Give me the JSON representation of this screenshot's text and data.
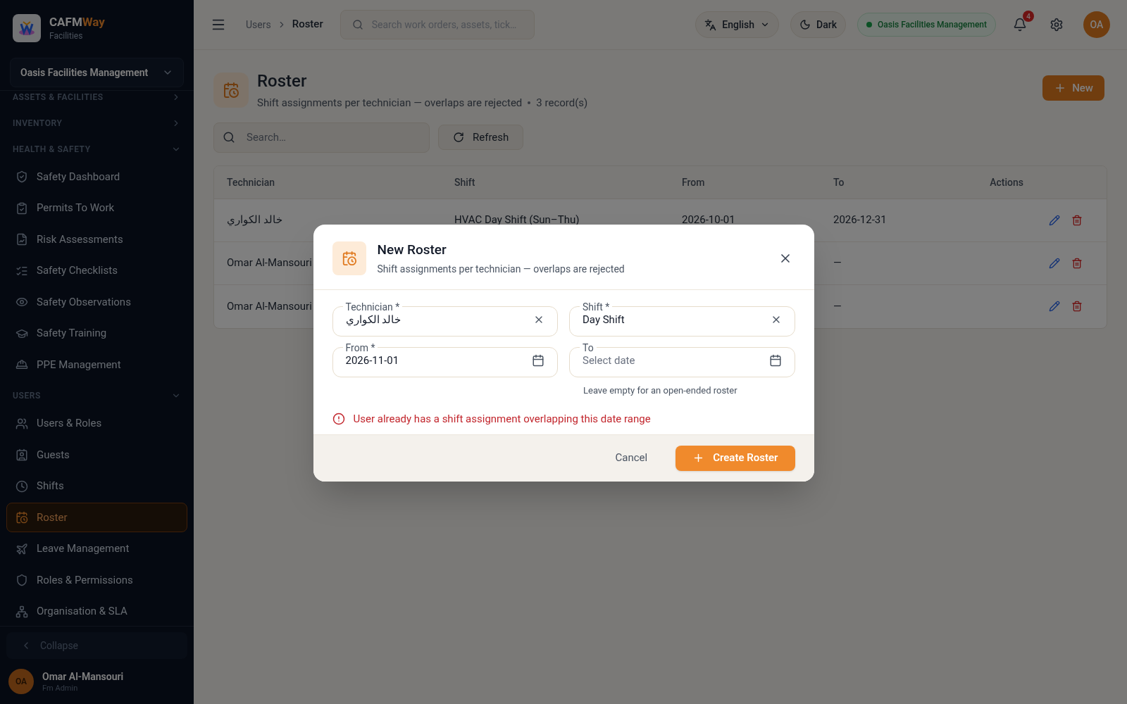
{
  "brand": {
    "name_part_1": "CAFM",
    "name_part_2": "Way",
    "subtitle": "Facilities"
  },
  "org_selector": {
    "value": "Oasis Facilities Management"
  },
  "sidebar": {
    "sections": [
      {
        "title": "ASSETS & FACILITIES",
        "expanded": false
      },
      {
        "title": "INVENTORY",
        "expanded": false
      },
      {
        "title": "HEALTH & SAFETY",
        "expanded": true,
        "items": [
          {
            "label": "Safety Dashboard",
            "selected": false
          },
          {
            "label": "Permits To Work",
            "selected": false
          },
          {
            "label": "Risk Assessments",
            "selected": false
          },
          {
            "label": "Safety Checklists",
            "selected": false
          },
          {
            "label": "Safety Observations",
            "selected": false
          },
          {
            "label": "Safety Training",
            "selected": false
          },
          {
            "label": "PPE Management",
            "selected": false
          }
        ]
      },
      {
        "title": "USERS",
        "expanded": true,
        "items": [
          {
            "label": "Users & Roles",
            "selected": false
          },
          {
            "label": "Guests",
            "selected": false
          },
          {
            "label": "Shifts",
            "selected": false
          },
          {
            "label": "Roster",
            "selected": true
          },
          {
            "label": "Leave Management",
            "selected": false
          },
          {
            "label": "Roles & Permissions",
            "selected": false
          },
          {
            "label": "Organisation & SLA",
            "selected": false
          }
        ]
      }
    ],
    "collapse": "Collapse",
    "user": {
      "initials": "OA",
      "name": "Omar Al-Mansouri",
      "role": "Fm Admin"
    }
  },
  "topbar": {
    "breadcrumb": [
      "Users",
      "Roster"
    ],
    "search_placeholder": "Search work orders, assets, tick…",
    "language": "English",
    "theme": "Dark",
    "org_badge": "Oasis Facilities Management",
    "notifications": "4",
    "avatar": "OA"
  },
  "page": {
    "title": "Roster",
    "subtitle": "Shift assignments per technician — overlaps are rejected",
    "record_count": "3 record(s)",
    "new_button": "New",
    "search_placeholder": "Search…",
    "refresh_button": "Refresh"
  },
  "table": {
    "columns": [
      "Technician",
      "Shift",
      "From",
      "To",
      "Actions"
    ],
    "rows": [
      {
        "technician": "خالد الكواري",
        "shift": "HVAC Day Shift (Sun–Thu)",
        "from": "2026-10-01",
        "to": "2026-12-31"
      },
      {
        "technician": "Omar Al-Mansouri",
        "to": "—"
      },
      {
        "technician": "Omar Al-Mansouri",
        "to": "—"
      }
    ]
  },
  "dialog": {
    "title": "New Roster",
    "subtitle": "Shift assignments per technician — overlaps are rejected",
    "fields": [
      {
        "label": "Technician *",
        "value": "خالد الكواري",
        "kind": "select"
      },
      {
        "label": "Shift *",
        "value": "Day Shift",
        "kind": "select"
      },
      {
        "label": "From *",
        "value": "2026-11-01",
        "kind": "date"
      },
      {
        "label": "To",
        "placeholder": "Select date",
        "kind": "date",
        "hint": "Leave empty for an open-ended roster"
      }
    ],
    "error": "User already has a shift assignment overlapping this date range",
    "cancel": "Cancel",
    "submit": "Create Roster"
  }
}
